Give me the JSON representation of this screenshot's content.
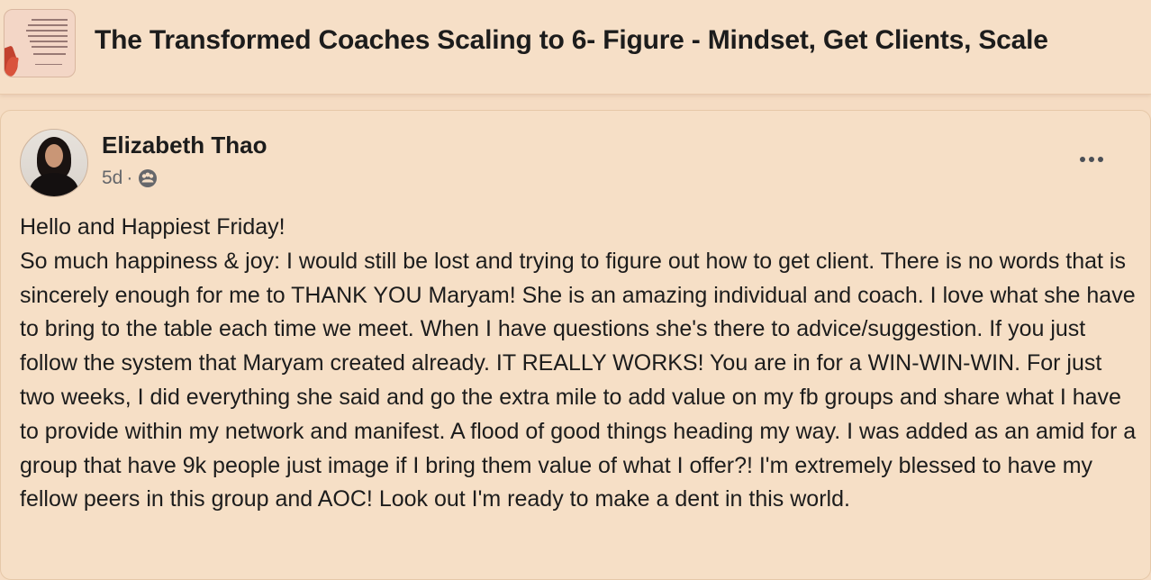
{
  "group": {
    "title": "The Transformed Coaches Scaling to 6- Figure - Mindset, Get Clients, Scale",
    "thumbnail_icon": "group-cover-image"
  },
  "post": {
    "author": "Elizabeth Thao",
    "time": "5d",
    "separator": "·",
    "audience_icon": "group-audience-icon",
    "more_icon": "more-options-icon",
    "body_lines": [
      "Hello and Happiest Friday!",
      "So much happiness & joy: I would still be lost and trying to figure out how to get client.  There is no words that is sincerely enough for me to THANK YOU Maryam!  She is an amazing individual and coach. I love what she have to bring to the table each time we meet. When I have questions she's there to advice/suggestion.  If you just follow the system that Maryam created already.  IT REALLY WORKS!  You are in for a WIN-WIN-WIN. For just two weeks, I did everything she said and go the extra mile to add value on my fb groups and share what I have to provide within my network and manifest.  A flood of good things heading my way. I was added as an amid for a group that have 9k people just image if I bring them value of what I offer?! I'm extremely blessed to have my fellow peers in this group and AOC!  Look out I'm ready to make a dent in this world."
    ]
  },
  "colors": {
    "background": "#f5dcc3",
    "card": "#f6dfc6",
    "text": "#1c1c1c",
    "meta": "#65676b"
  }
}
